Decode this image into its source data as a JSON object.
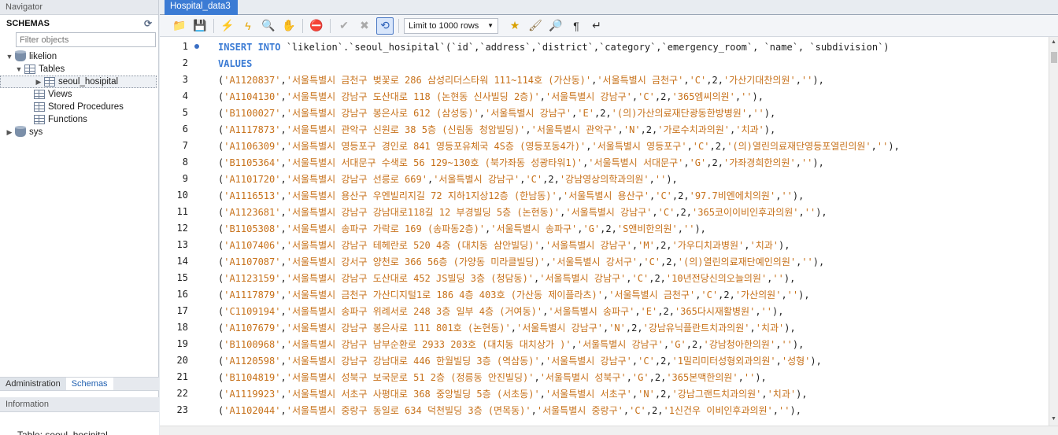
{
  "navigator": {
    "title": "Navigator",
    "schemas_label": "SCHEMAS",
    "filter_placeholder": "Filter objects",
    "tree": {
      "db1": "likelion",
      "tables": "Tables",
      "table1": "seoul_hosipital",
      "views": "Views",
      "procs": "Stored Procedures",
      "funcs": "Functions",
      "db2": "sys"
    },
    "tabs": {
      "admin": "Administration",
      "schemas": "Schemas"
    },
    "info_title": "Information",
    "info_text": "Table: seoul_hosipital"
  },
  "editor_tab": {
    "title": "Hospital_data3"
  },
  "toolbar": {
    "limit": "Limit to 1000 rows"
  },
  "colors": {
    "keyword": "#3b7bd4",
    "string": "#c7711a",
    "tab_active": "#3b7bd4"
  },
  "code": {
    "l1_kw1": "INSERT INTO",
    "l1_rest": " `likelion`.`seoul_hosipital`(`id`,`address`,`district`,`category`,`emergency_room`, `name`, `subdivision`)",
    "l2_kw": "VALUES",
    "rows": [
      {
        "n": "3",
        "id": "'A1120837'",
        "addr": "'서울특별시 금천구 벚꽃로 286 삼성리더스타워 111~114호 (가산동)'",
        "dist": "'서울특별시 금천구'",
        "cat": "'C'",
        "er": "2",
        "name": "'가산기대찬의원'",
        "sub": "''"
      },
      {
        "n": "4",
        "id": "'A1104130'",
        "addr": "'서울특별시 강남구 도산대로 118 (논현동 신사빌딩 2층)'",
        "dist": "'서울특별시 강남구'",
        "cat": "'C'",
        "er": "2",
        "name": "'365엠씨의원'",
        "sub": "''"
      },
      {
        "n": "5",
        "id": "'B1100027'",
        "addr": "'서울특별시 강남구 봉은사로 612 (삼성동)'",
        "dist": "'서울특별시 강남구'",
        "cat": "'E'",
        "er": "2",
        "name": "'(의)가산의료재단광동한방병원'",
        "sub": "''"
      },
      {
        "n": "6",
        "id": "'A1117873'",
        "addr": "'서울특별시 관악구 신원로 38 5층 (신림동 청암빌딩)'",
        "dist": "'서울특별시 관악구'",
        "cat": "'N'",
        "er": "2",
        "name": "'가로수치과의원'",
        "sub": "'치과'"
      },
      {
        "n": "7",
        "id": "'A1106309'",
        "addr": "'서울특별시 영등포구 경인로 841 영등포유체국 4S층 (영등포동4가)'",
        "dist": "'서울특별시 영등포구'",
        "cat": "'C'",
        "er": "2",
        "name": "'(의)열린의료재단영등포열린의원'",
        "sub": "''"
      },
      {
        "n": "8",
        "id": "'B1105364'",
        "addr": "'서울특별시 서대문구 수색로 56 129~130호 (북가좌동 성광타워1)'",
        "dist": "'서울특별시 서대문구'",
        "cat": "'G'",
        "er": "2",
        "name": "'가좌경희한의원'",
        "sub": "''"
      },
      {
        "n": "9",
        "id": "'A1101720'",
        "addr": "'서울특별시 강남구 선릉로 669'",
        "dist": "'서울특별시 강남구'",
        "cat": "'C'",
        "er": "2",
        "name": "'강남영상의학과의원'",
        "sub": "''"
      },
      {
        "n": "10",
        "id": "'A1116513'",
        "addr": "'서울특별시 용산구 우엔빌리지길 72 지하1지상12층 (한남동)'",
        "dist": "'서울특별시 용산구'",
        "cat": "'C'",
        "er": "2",
        "name": "'97.7비엔에치의원'",
        "sub": "''"
      },
      {
        "n": "11",
        "id": "'A1123681'",
        "addr": "'서울특별시 강남구 강남대로118길 12 부경빌딩 5층 (논현동)'",
        "dist": "'서울특별시 강남구'",
        "cat": "'C'",
        "er": "2",
        "name": "'365코이이비인후과의원'",
        "sub": "''"
      },
      {
        "n": "12",
        "id": "'B1105308'",
        "addr": "'서울특별시 송파구 가락로 169 (송파동2층)'",
        "dist": "'서울특별시 송파구'",
        "cat": "'G'",
        "er": "2",
        "name": "'S앤비한의원'",
        "sub": "''"
      },
      {
        "n": "13",
        "id": "'A1107406'",
        "addr": "'서울특별시 강남구 테헤란로 520 4층 (대치동 삼안빌딩)'",
        "dist": "'서울특별시 강남구'",
        "cat": "'M'",
        "er": "2",
        "name": "'가우디치과병원'",
        "sub": "'치과'"
      },
      {
        "n": "14",
        "id": "'A1107087'",
        "addr": "'서울특별시 강서구 양천로 366 56층 (가양동 미라클빌딩)'",
        "dist": "'서울특별시 강서구'",
        "cat": "'C'",
        "er": "2",
        "name": "'(의)열린의료재단예인의원'",
        "sub": "''"
      },
      {
        "n": "15",
        "id": "'A1123159'",
        "addr": "'서울특별시 강남구 도산대로 452 JS빌딩 3층 (청담동)'",
        "dist": "'서울특별시 강남구'",
        "cat": "'C'",
        "er": "2",
        "name": "'10년전당신의오늘의원'",
        "sub": "''"
      },
      {
        "n": "16",
        "id": "'A1117879'",
        "addr": "'서울특별시 금천구 가산디지털1로 186 4층 403호 (가산동 제이플라츠)'",
        "dist": "'서울특별시 금천구'",
        "cat": "'C'",
        "er": "2",
        "name": "'가산의원'",
        "sub": "''"
      },
      {
        "n": "17",
        "id": "'C1109194'",
        "addr": "'서울특별시 송파구 위례서로 248 3층 일부 4층 (거여동)'",
        "dist": "'서울특별시 송파구'",
        "cat": "'E'",
        "er": "2",
        "name": "'365다시재활병원'",
        "sub": "''"
      },
      {
        "n": "18",
        "id": "'A1107679'",
        "addr": "'서울특별시 강남구 봉은사로 111 801호 (논현동)'",
        "dist": "'서울특별시 강남구'",
        "cat": "'N'",
        "er": "2",
        "name": "'강남유닉플란트치과의원'",
        "sub": "'치과'"
      },
      {
        "n": "19",
        "id": "'B1100968'",
        "addr": "'서울특별시 강남구 남부순환로 2933 203호 (대치동 대치상가 )'",
        "dist": "'서울특별시 강남구'",
        "cat": "'G'",
        "er": "2",
        "name": "'강남청아한의원'",
        "sub": "''"
      },
      {
        "n": "20",
        "id": "'A1120598'",
        "addr": "'서울특별시 강남구 강남대로 446 한월빌딩 3층 (역삼동)'",
        "dist": "'서울특별시 강남구'",
        "cat": "'C'",
        "er": "2",
        "name": "'1밀리미터성형외과의원'",
        "sub": "'성형'"
      },
      {
        "n": "21",
        "id": "'B1104819'",
        "addr": "'서울특별시 성북구 보국문로 51 2층 (정릉동 안진빌딩)'",
        "dist": "'서울특별시 성북구'",
        "cat": "'G'",
        "er": "2",
        "name": "'365본맥한의원'",
        "sub": "''"
      },
      {
        "n": "22",
        "id": "'A1119923'",
        "addr": "'서울특별시 서초구 사평대로 368 중앙빌딩 5층 (서초동)'",
        "dist": "'서울특별시 서초구'",
        "cat": "'N'",
        "er": "2",
        "name": "'강남그랜드치과의원'",
        "sub": "'치과'"
      },
      {
        "n": "23",
        "id": "'A1102044'",
        "addr": "'서울특별시 중랑구 동일로 634 덕천빌딩 3층 (면목동)'",
        "dist": "'서울특별시 중랑구'",
        "cat": "'C'",
        "er": "2",
        "name": "'1신건우 이비인후과의원'",
        "sub": "''"
      }
    ]
  }
}
